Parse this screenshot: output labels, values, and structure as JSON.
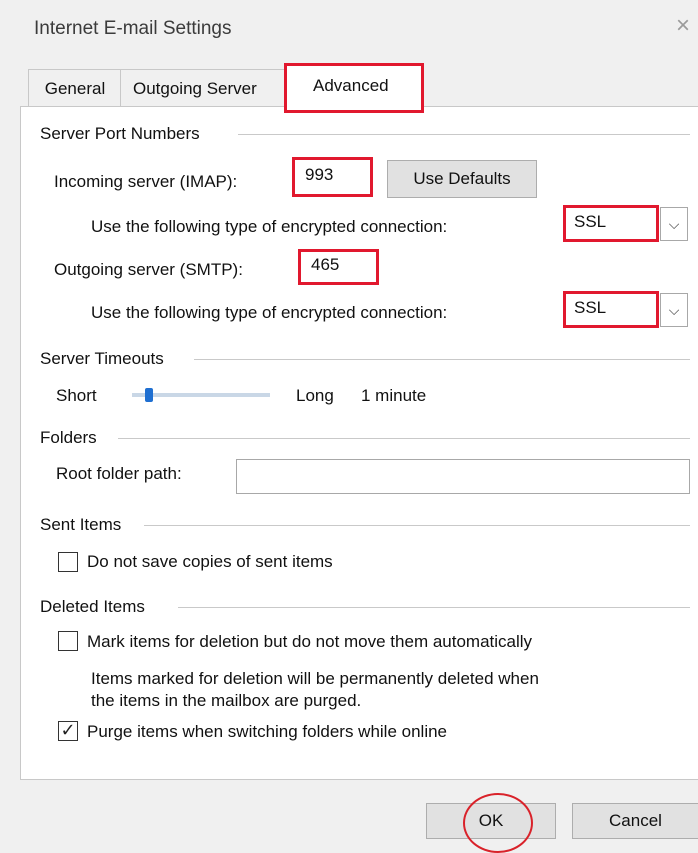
{
  "window": {
    "title": "Internet E-mail Settings",
    "close_glyph": "×"
  },
  "tabs": {
    "general": "General",
    "outgoing": "Outgoing Server",
    "advanced": "Advanced"
  },
  "server_ports": {
    "heading": "Server Port Numbers",
    "incoming_label": "Incoming server (IMAP):",
    "incoming_value": "993",
    "use_defaults": "Use Defaults",
    "enc_label_1": "Use the following type of encrypted connection:",
    "enc_value_1": "SSL",
    "outgoing_label": "Outgoing server (SMTP):",
    "outgoing_value": "465",
    "enc_label_2": "Use the following type of encrypted connection:",
    "enc_value_2": "SSL"
  },
  "timeouts": {
    "heading": "Server Timeouts",
    "short": "Short",
    "long": "Long",
    "value": "1 minute",
    "slider_level": 0.12
  },
  "folders": {
    "heading": "Folders",
    "root_label": "Root folder path:",
    "root_value": ""
  },
  "sent_items": {
    "heading": "Sent Items",
    "no_copies": "Do not save copies of sent items",
    "no_copies_checked": false
  },
  "deleted_items": {
    "heading": "Deleted Items",
    "mark_label": "Mark items for deletion but do not move them automatically",
    "mark_checked": false,
    "note_line1": "Items marked for deletion will be permanently deleted when",
    "note_line2": "the items in the mailbox are purged.",
    "purge_label": "Purge items when switching folders while online",
    "purge_checked": true,
    "check_glyph": "✓"
  },
  "buttons": {
    "ok": "OK",
    "cancel": "Cancel"
  },
  "dropdown_glyph": "⌵"
}
